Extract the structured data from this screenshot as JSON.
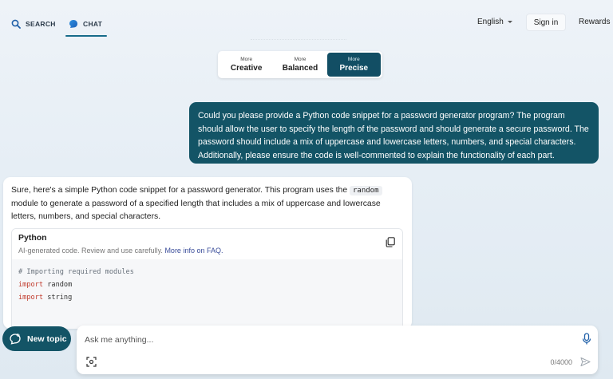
{
  "nav": {
    "search_label": "SEARCH",
    "chat_label": "CHAT"
  },
  "header": {
    "language": "English",
    "sign_in": "Sign in",
    "rewards": "Rewards"
  },
  "tone": {
    "options": [
      {
        "small": "More",
        "label": "Creative",
        "active": false
      },
      {
        "small": "More",
        "label": "Balanced",
        "active": false
      },
      {
        "small": "More",
        "label": "Precise",
        "active": true
      }
    ]
  },
  "conversation": {
    "user_message": "Could you please provide a Python code snippet for a password generator program? The program should allow the user to specify the length of the password and should generate a secure password. The password should include a mix of uppercase and lowercase letters, numbers, and special characters. Additionally, please ensure the code is well-commented to explain the functionality of each part.",
    "bot_intro_before": "Sure, here's a simple Python code snippet for a password generator. This program uses the ",
    "bot_inline_code": "random",
    "bot_intro_after": " module to generate a password of a specified length that includes a mix of uppercase and lowercase letters, numbers, and special characters.",
    "code_block": {
      "language": "Python",
      "note": "AI-generated code. Review and use carefully. ",
      "note_link": "More info on FAQ.",
      "lines": [
        {
          "type": "comment",
          "text": "# Importing required modules"
        },
        {
          "type": "import",
          "kw": "import",
          "text": " random"
        },
        {
          "type": "import",
          "kw": "import",
          "text": " string"
        }
      ]
    }
  },
  "composer": {
    "new_topic": "New topic",
    "placeholder": "Ask me anything...",
    "counter": "0/4000"
  },
  "colors": {
    "accent": "#135466",
    "active_tone": "#124e64"
  },
  "icons": {
    "search": "search-icon",
    "chat": "chat-icon",
    "copy": "copy-icon",
    "new_topic": "new-topic-icon",
    "mic": "microphone-icon",
    "scan": "image-scan-icon",
    "send": "send-icon"
  }
}
